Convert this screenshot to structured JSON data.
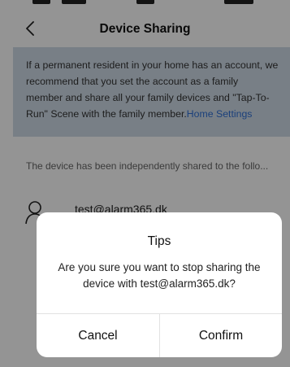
{
  "nav": {
    "title": "Device Sharing",
    "back_icon": "chevron-left-icon"
  },
  "info": {
    "line1": "If a permanent resident in your home has an account, we",
    "line2": "recommend that you set the account as a family",
    "line3": "member and share all your family devices and \"Tap-To-",
    "line4_text": "Run\" Scene with the family member.",
    "line4_link": "Home Settings"
  },
  "shared": {
    "section_label": "The device has been independently shared to the follo...",
    "users": [
      {
        "email": "test@alarm365.dk",
        "icon": "user-avatar-icon"
      }
    ]
  },
  "dialog": {
    "title": "Tips",
    "message_line1": "Are you sure you want to stop sharing the",
    "message_line2": "device with test@alarm365.dk?",
    "cancel_label": "Cancel",
    "confirm_label": "Confirm"
  },
  "colors": {
    "info_bg": "#cfdbe7",
    "link": "#2f6fd4",
    "overlay": "rgba(0,0,0,0.42)"
  }
}
